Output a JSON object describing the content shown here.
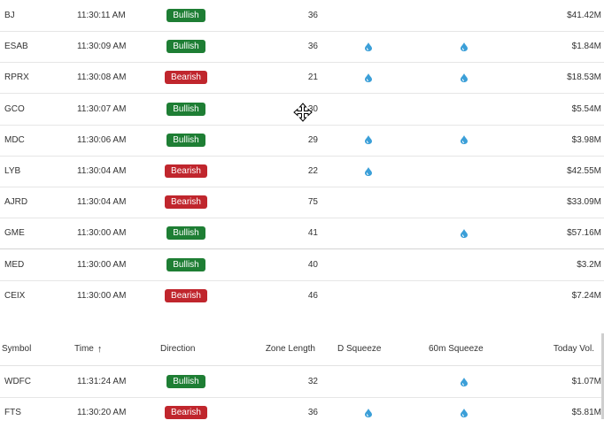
{
  "upper_rows": [
    {
      "symbol": "BJ",
      "time": "11:30:11 AM",
      "direction": "Bullish",
      "zone": "36",
      "d_squeeze": false,
      "sq60": false,
      "volume": "$41.42M"
    },
    {
      "symbol": "ESAB",
      "time": "11:30:09 AM",
      "direction": "Bullish",
      "zone": "36",
      "d_squeeze": true,
      "sq60": true,
      "volume": "$1.84M"
    },
    {
      "symbol": "RPRX",
      "time": "11:30:08 AM",
      "direction": "Bearish",
      "zone": "21",
      "d_squeeze": true,
      "sq60": true,
      "volume": "$18.53M"
    },
    {
      "symbol": "GCO",
      "time": "11:30:07 AM",
      "direction": "Bullish",
      "zone": "30",
      "d_squeeze": false,
      "sq60": false,
      "volume": "$5.54M"
    },
    {
      "symbol": "MDC",
      "time": "11:30:06 AM",
      "direction": "Bullish",
      "zone": "29",
      "d_squeeze": true,
      "sq60": true,
      "volume": "$3.98M"
    },
    {
      "symbol": "LYB",
      "time": "11:30:04 AM",
      "direction": "Bearish",
      "zone": "22",
      "d_squeeze": true,
      "sq60": false,
      "volume": "$42.55M"
    },
    {
      "symbol": "AJRD",
      "time": "11:30:04 AM",
      "direction": "Bearish",
      "zone": "75",
      "d_squeeze": false,
      "sq60": false,
      "volume": "$33.09M"
    },
    {
      "symbol": "GME",
      "time": "11:30:00 AM",
      "direction": "Bullish",
      "zone": "41",
      "d_squeeze": false,
      "sq60": true,
      "volume": "$57.16M"
    },
    {
      "symbol": "MED",
      "time": "11:30:00 AM",
      "direction": "Bullish",
      "zone": "40",
      "d_squeeze": false,
      "sq60": false,
      "volume": "$3.2M"
    },
    {
      "symbol": "CEIX",
      "time": "11:30:00 AM",
      "direction": "Bearish",
      "zone": "46",
      "d_squeeze": false,
      "sq60": false,
      "volume": "$7.24M"
    }
  ],
  "header": {
    "symbol": "Symbol",
    "time": "Time",
    "time_sort_icon": "arrow-up-icon",
    "direction": "Direction",
    "zone": "Zone Length",
    "d_squeeze": "D Squeeze",
    "sq60": "60m Squeeze",
    "volume": "Today Vol."
  },
  "lower_rows": [
    {
      "symbol": "WDFC",
      "time": "11:31:24 AM",
      "direction": "Bullish",
      "zone": "32",
      "d_squeeze": false,
      "sq60": true,
      "volume": "$1.07M"
    },
    {
      "symbol": "FTS",
      "time": "11:30:20 AM",
      "direction": "Bearish",
      "zone": "36",
      "d_squeeze": true,
      "sq60": true,
      "volume": "$5.81M"
    }
  ],
  "colors": {
    "bullish": "#1e7e34",
    "bearish": "#c0262d",
    "squeeze_drop": "#3b9fd8"
  },
  "icons": {
    "squeeze": "water-drop-icon",
    "cursor": "move-cursor-icon"
  }
}
